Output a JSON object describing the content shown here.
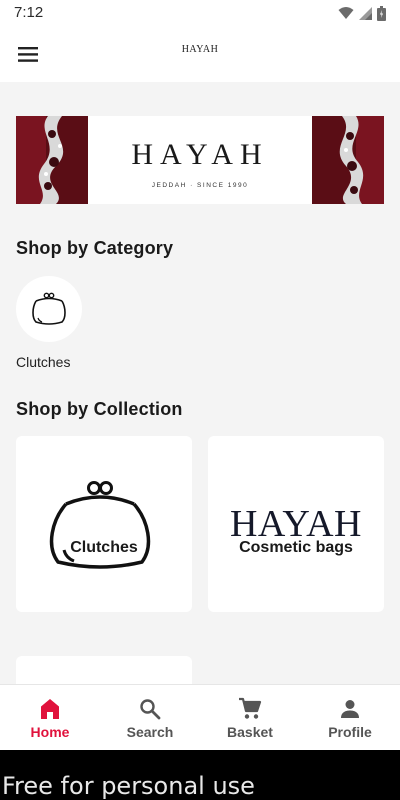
{
  "status_bar": {
    "time": "7:12",
    "icons": [
      "wifi-icon",
      "signal-icon",
      "battery-icon"
    ]
  },
  "app_bar": {
    "title": "HAYAH",
    "menu_icon": "hamburger-menu-icon"
  },
  "banner": {
    "brand": "HAYAH",
    "subtitle": "JEDDAH · SINCE 1990"
  },
  "category_section": {
    "title": "Shop by Category",
    "items": [
      {
        "label": "Clutches",
        "icon": "clutch-purse-icon"
      }
    ]
  },
  "collection_section": {
    "title": "Shop by Collection",
    "items": [
      {
        "label": "Clutches",
        "image": "clutch-purse-icon"
      },
      {
        "label": "Cosmetic bags",
        "image_text": "HAYAH"
      }
    ]
  },
  "bottom_nav": {
    "items": [
      {
        "label": "Home",
        "icon": "home-icon",
        "active": true
      },
      {
        "label": "Search",
        "icon": "search-icon",
        "active": false
      },
      {
        "label": "Basket",
        "icon": "cart-icon",
        "active": false
      },
      {
        "label": "Profile",
        "icon": "person-icon",
        "active": false
      }
    ]
  },
  "watermark": {
    "text": "Free for personal use"
  },
  "colors": {
    "accent": "#e0123c",
    "nav_inactive": "#555555",
    "background": "#f4f4f4"
  }
}
